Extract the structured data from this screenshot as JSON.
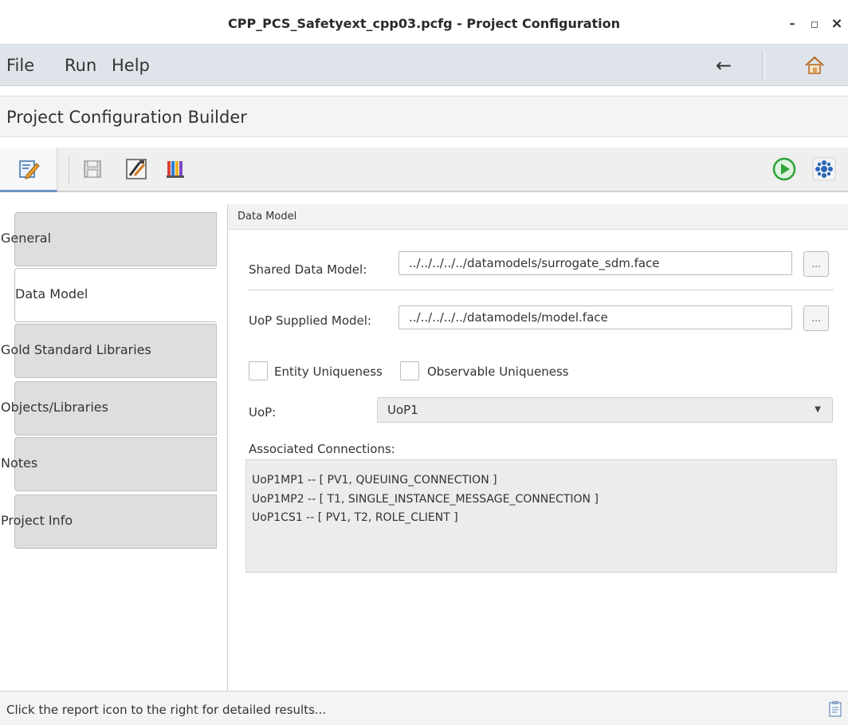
{
  "window": {
    "title": "CPP_PCS_Safetyext_cpp03.pcfg - Project Configuration",
    "minimize": "–",
    "maximize": "◻",
    "close": "×"
  },
  "menubar": {
    "items": [
      "File",
      "Run",
      "Help"
    ],
    "back_icon": "←"
  },
  "builder": {
    "title": "Project Configuration Builder"
  },
  "toolbar": {
    "icons": [
      "edit-config-icon",
      "save-icon",
      "tools-icon",
      "library-icon",
      "run-icon",
      "settings-icon"
    ]
  },
  "tabs": [
    {
      "label": "General",
      "active": false
    },
    {
      "label": "Data Model",
      "active": true
    },
    {
      "label": "Gold Standard Libraries",
      "active": false
    },
    {
      "label": "Objects/Libraries",
      "active": false
    },
    {
      "label": "Notes",
      "active": false
    },
    {
      "label": "Project Info",
      "active": false
    }
  ],
  "panel": {
    "title": "Data Model",
    "shared_data_model": {
      "label": "Shared Data Model:",
      "value": "../../../../../datamodels/surrogate_sdm.face",
      "browse": "..."
    },
    "uop_supplied_model": {
      "label": "UoP Supplied Model:",
      "value": "../../../../../datamodels/model.face",
      "browse": "..."
    },
    "entity_uniqueness": {
      "label": "Entity Uniqueness",
      "checked": false
    },
    "observable_uniqueness": {
      "label": "Observable Uniqueness",
      "checked": false
    },
    "uop": {
      "label": "UoP:",
      "value": "UoP1",
      "arrow": "▼"
    },
    "associated_connections": {
      "label": "Associated Connections:",
      "items": [
        "UoP1MP1 -- [ PV1, QUEUING_CONNECTION ]",
        "UoP1MP2 -- [ T1, SINGLE_INSTANCE_MESSAGE_CONNECTION ]",
        "UoP1CS1 -- [ PV1, T2, ROLE_CLIENT ]"
      ]
    }
  },
  "statusbar": {
    "message": "Click the report icon to the right for detailed results..."
  },
  "colors": {
    "menubar": "#dfe4ea",
    "run_green": "#2fa43a",
    "settings_blue": "#2a66b8"
  }
}
